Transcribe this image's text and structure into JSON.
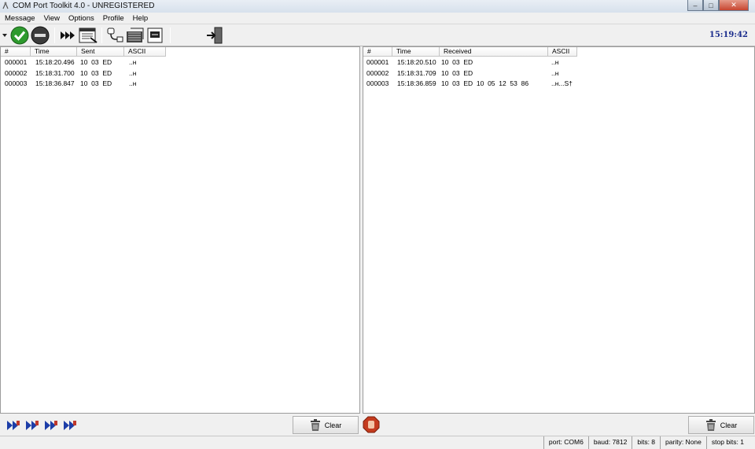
{
  "window": {
    "title": "COM Port Toolkit 4.0 - UNREGISTERED",
    "min_glyph": "–",
    "max_glyph": "□",
    "close_glyph": "✕"
  },
  "menu": {
    "items": [
      "Message",
      "View",
      "Options",
      "Profile",
      "Help"
    ]
  },
  "toolbar": {
    "icons": [
      "dropdown-arrow-icon",
      "connect-icon",
      "disconnect-icon",
      "send-fast-forward-icon",
      "log-view-icon",
      "cable-plug-icon",
      "macro-icon",
      "terminal-icon",
      "exit-door-icon"
    ],
    "clock": "15:19:42"
  },
  "sent": {
    "columns": [
      "#",
      "Time",
      "Sent",
      "ASCII"
    ],
    "rows": [
      {
        "num": "000001",
        "time": "15:18:20.496",
        "data": "10  03  ED",
        "ascii": "..н"
      },
      {
        "num": "000002",
        "time": "15:18:31.700",
        "data": "10  03  ED",
        "ascii": "..н"
      },
      {
        "num": "000003",
        "time": "15:18:36.847",
        "data": "10  03  ED",
        "ascii": "..н"
      }
    ]
  },
  "received": {
    "columns": [
      "#",
      "Time",
      "Received",
      "ASCII"
    ],
    "rows": [
      {
        "num": "000001",
        "time": "15:18:20.510",
        "data": "10  03  ED",
        "ascii": "..н"
      },
      {
        "num": "000002",
        "time": "15:18:31.709",
        "data": "10  03  ED",
        "ascii": "..н"
      },
      {
        "num": "000003",
        "time": "15:18:36.859",
        "data": "10  03  ED  10  05  12  53  86",
        "ascii": "..н...S†"
      }
    ]
  },
  "bottom": {
    "clear_label": "Clear",
    "macro_buttons": 4
  },
  "status": {
    "port": "port: COM6",
    "baud": "baud: 7812",
    "bits": "bits: 8",
    "parity": "parity: None",
    "stop": "stop bits: 1"
  },
  "colors": {
    "accent": "#1a2c8c",
    "connect": "#2e9a2e",
    "disconnect": "#3c3c3c",
    "stop": "#c43b1e"
  }
}
